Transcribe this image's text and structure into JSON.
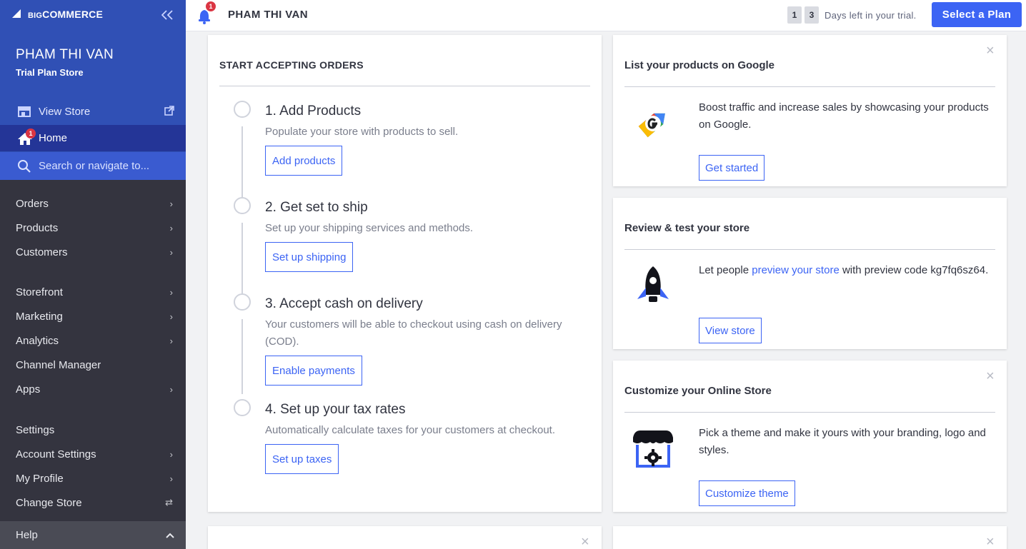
{
  "brand": {
    "logo_text": "BIGCOMMERCE",
    "logo_prefix": "BIG",
    "logo_suffix": "COMMERCE",
    "accent": "#3c64f4",
    "sidebar_dark": "#34343f"
  },
  "sidebar": {
    "store_name": "PHAM THI VAN",
    "plan_label": "Trial Plan Store",
    "view_store": "View Store",
    "home": {
      "label": "Home",
      "badge": "1"
    },
    "search_placeholder": "Search or navigate to...",
    "group1": [
      {
        "label": "Orders",
        "chevron": "›"
      },
      {
        "label": "Products",
        "chevron": "›"
      },
      {
        "label": "Customers",
        "chevron": "›"
      }
    ],
    "group2": [
      {
        "label": "Storefront",
        "chevron": "›"
      },
      {
        "label": "Marketing",
        "chevron": "›"
      },
      {
        "label": "Analytics",
        "chevron": "›"
      },
      {
        "label": "Channel Manager",
        "chevron": ""
      },
      {
        "label": "Apps",
        "chevron": "›"
      }
    ],
    "group3": [
      {
        "label": "Settings",
        "chevron": ""
      },
      {
        "label": "Account Settings",
        "chevron": "›"
      },
      {
        "label": "My Profile",
        "chevron": "›"
      },
      {
        "label": "Change Store",
        "chevron": "⇄"
      }
    ],
    "help": "Help"
  },
  "header": {
    "notification_count": "1",
    "store_name": "PHAM THI VAN",
    "trial_digits": [
      "1",
      "3"
    ],
    "trial_text": "Days left in your trial.",
    "plan_button": "Select a Plan"
  },
  "orders": {
    "title": "START ACCEPTING ORDERS",
    "steps": [
      {
        "title": "1. Add Products",
        "desc": "Populate your store with products to sell.",
        "button": "Add products"
      },
      {
        "title": "2. Get set to ship",
        "desc": "Set up your shipping services and methods.",
        "button": "Set up shipping"
      },
      {
        "title": "3. Accept cash on delivery",
        "desc": "Your customers will be able to checkout using cash on delivery (COD).",
        "button": "Enable payments"
      },
      {
        "title": "4. Set up your tax rates",
        "desc": "Automatically calculate taxes for your customers at checkout.",
        "button": "Set up taxes"
      }
    ]
  },
  "cards": {
    "google": {
      "title": "List your products on Google",
      "text": "Boost traffic and increase sales by showcasing your products on Google.",
      "button": "Get started",
      "close": "×"
    },
    "review": {
      "title": "Review & test your store",
      "text_before": "Let people ",
      "link": "preview your store",
      "text_after": " with preview code kg7fq6sz64.",
      "button": "View store"
    },
    "customize": {
      "title": "Customize your Online Store",
      "text": "Pick a theme and make it yours with your branding, logo and styles.",
      "button": "Customize theme",
      "close": "×"
    },
    "bottom_close": "×"
  }
}
